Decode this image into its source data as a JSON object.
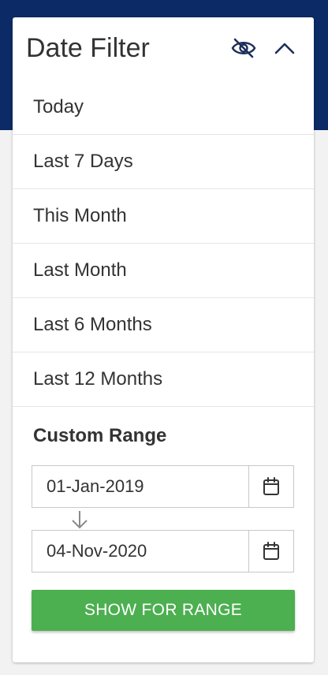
{
  "colors": {
    "header_bg": "#0b2a66",
    "accent": "#1c2e5a",
    "button_bg": "#4caf50",
    "button_text": "#ffffff"
  },
  "filter": {
    "title": "Date Filter",
    "icons": {
      "visibility": "eye-off-icon",
      "collapse": "chevron-up-icon"
    },
    "options": [
      "Today",
      "Last 7 Days",
      "This Month",
      "Last Month",
      "Last 6 Months",
      "Last 12 Months"
    ],
    "custom": {
      "label": "Custom Range",
      "from": "01-Jan-2019",
      "to": "04-Nov-2020",
      "calendar_icon": "calendar-icon",
      "arrow_icon": "arrow-down-icon",
      "button_label": "SHOW FOR RANGE"
    }
  }
}
